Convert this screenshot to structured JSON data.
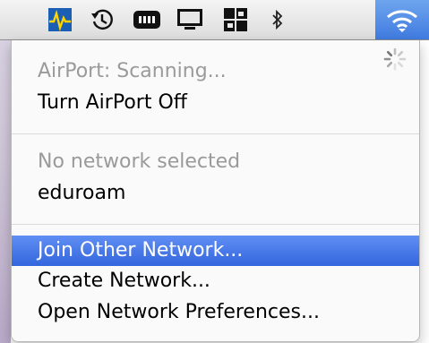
{
  "menubar": {
    "icons": [
      "activity-monitor-icon",
      "time-machine-icon",
      "battery-icon",
      "display-icon",
      "spaces-icon",
      "bluetooth-icon",
      "wifi-icon"
    ]
  },
  "menu": {
    "status": "AirPort: Scanning...",
    "turn_off": "Turn AirPort Off",
    "no_network": "No network selected",
    "network": "eduroam",
    "join_other": "Join Other Network...",
    "create": "Create Network...",
    "prefs": "Open Network Preferences..."
  },
  "colors": {
    "selection": "#3f73e4",
    "wifi_highlight": "#4b86e6"
  }
}
